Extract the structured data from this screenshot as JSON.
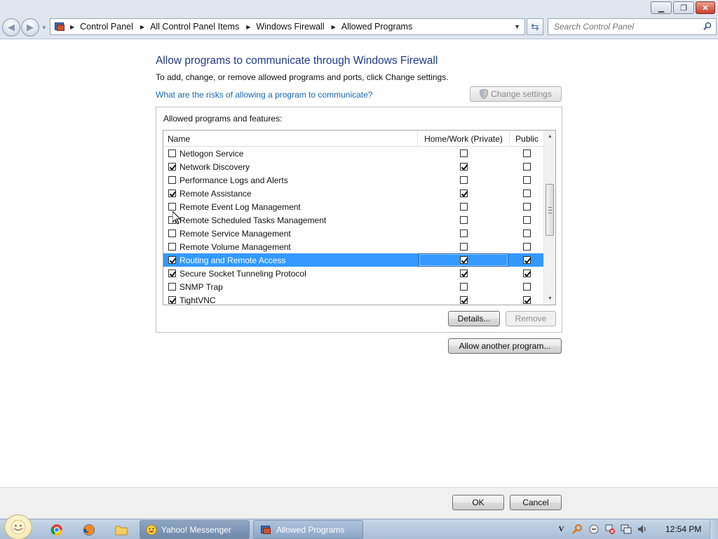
{
  "window": {
    "minimize_label": "▁",
    "maximize_label": "❐",
    "close_label": "✕"
  },
  "address": {
    "crumbs": [
      "Control Panel",
      "All Control Panel Items",
      "Windows Firewall",
      "Allowed Programs"
    ],
    "icon": "control-panel-icon"
  },
  "search": {
    "placeholder": "Search Control Panel"
  },
  "page": {
    "heading": "Allow programs to communicate through Windows Firewall",
    "subtext": "To add, change, or remove allowed programs and ports, click Change settings.",
    "risk_link": "What are the risks of allowing a program to communicate?",
    "change_settings": "Change settings",
    "group_label": "Allowed programs and features:"
  },
  "table": {
    "columns": {
      "name": "Name",
      "home": "Home/Work (Private)",
      "public": "Public"
    },
    "rows": [
      {
        "name": "Netlogon Service",
        "enabled": false,
        "home": false,
        "public": false,
        "selected": false
      },
      {
        "name": "Network Discovery",
        "enabled": true,
        "home": true,
        "public": false,
        "selected": false
      },
      {
        "name": "Performance Logs and Alerts",
        "enabled": false,
        "home": false,
        "public": false,
        "selected": false
      },
      {
        "name": "Remote Assistance",
        "enabled": true,
        "home": true,
        "public": false,
        "selected": false
      },
      {
        "name": "Remote Event Log Management",
        "enabled": false,
        "home": false,
        "public": false,
        "selected": false
      },
      {
        "name": "Remote Scheduled Tasks Management",
        "enabled": false,
        "home": false,
        "public": false,
        "selected": false
      },
      {
        "name": "Remote Service Management",
        "enabled": false,
        "home": false,
        "public": false,
        "selected": false
      },
      {
        "name": "Remote Volume Management",
        "enabled": false,
        "home": false,
        "public": false,
        "selected": false
      },
      {
        "name": "Routing and Remote Access",
        "enabled": true,
        "home": true,
        "public": true,
        "selected": true
      },
      {
        "name": "Secure Socket Tunneling Protocol",
        "enabled": true,
        "home": true,
        "public": true,
        "selected": false
      },
      {
        "name": "SNMP Trap",
        "enabled": false,
        "home": false,
        "public": false,
        "selected": false
      },
      {
        "name": "TightVNC",
        "enabled": true,
        "home": true,
        "public": true,
        "selected": false
      }
    ]
  },
  "buttons": {
    "details": "Details...",
    "remove": "Remove",
    "allow_another": "Allow another program...",
    "ok": "OK",
    "cancel": "Cancel"
  },
  "taskbar": {
    "tasks": [
      {
        "label": "Yahoo! Messenger",
        "icon": "yahoo-messenger-icon"
      },
      {
        "label": "Allowed Programs",
        "icon": "control-panel-icon"
      }
    ],
    "pinned": [
      "chrome-icon",
      "firefox-icon",
      "folder-icon"
    ],
    "tray": [
      "vnc-icon",
      "search-tray-icon",
      "messenger-tray-icon",
      "network-error-icon",
      "network-icon",
      "volume-icon"
    ],
    "clock": "12:54 PM"
  },
  "colors": {
    "selection": "#3399ff",
    "heading": "#1e3a8a",
    "link": "#1a66b0"
  }
}
